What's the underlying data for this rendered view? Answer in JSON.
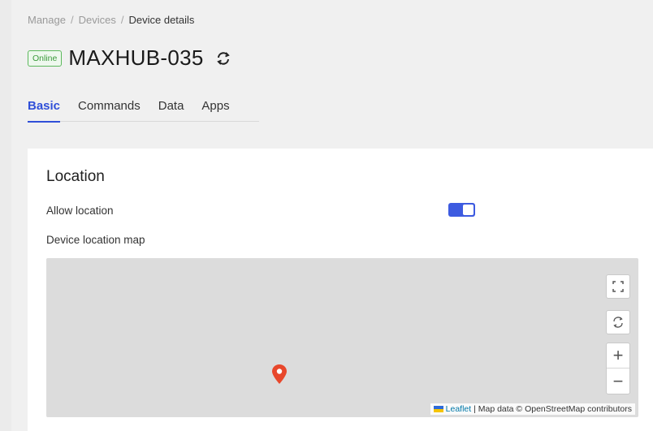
{
  "breadcrumb": {
    "items": [
      "Manage",
      "Devices"
    ],
    "separator": "/",
    "current": "Device details"
  },
  "device": {
    "status": "Online",
    "name": "MAXHUB-035"
  },
  "tabs": [
    {
      "label": "Basic",
      "active": true
    },
    {
      "label": "Commands",
      "active": false
    },
    {
      "label": "Data",
      "active": false
    },
    {
      "label": "Apps",
      "active": false
    }
  ],
  "location": {
    "title": "Location",
    "allow_label": "Allow location",
    "allow_enabled": true,
    "map_label": "Device location map"
  },
  "map": {
    "fullscreen_icon": "fullscreen-icon",
    "reset_icon": "reset-view-icon",
    "zoom_in": "+",
    "zoom_out": "−",
    "attribution": {
      "leaflet": "Leaflet",
      "separator": " | ",
      "text": "Map data © OpenStreetMap contributors"
    }
  },
  "colors": {
    "accent": "#2f4fd8",
    "online": "#3a9a3a",
    "marker": "#e8472b"
  }
}
